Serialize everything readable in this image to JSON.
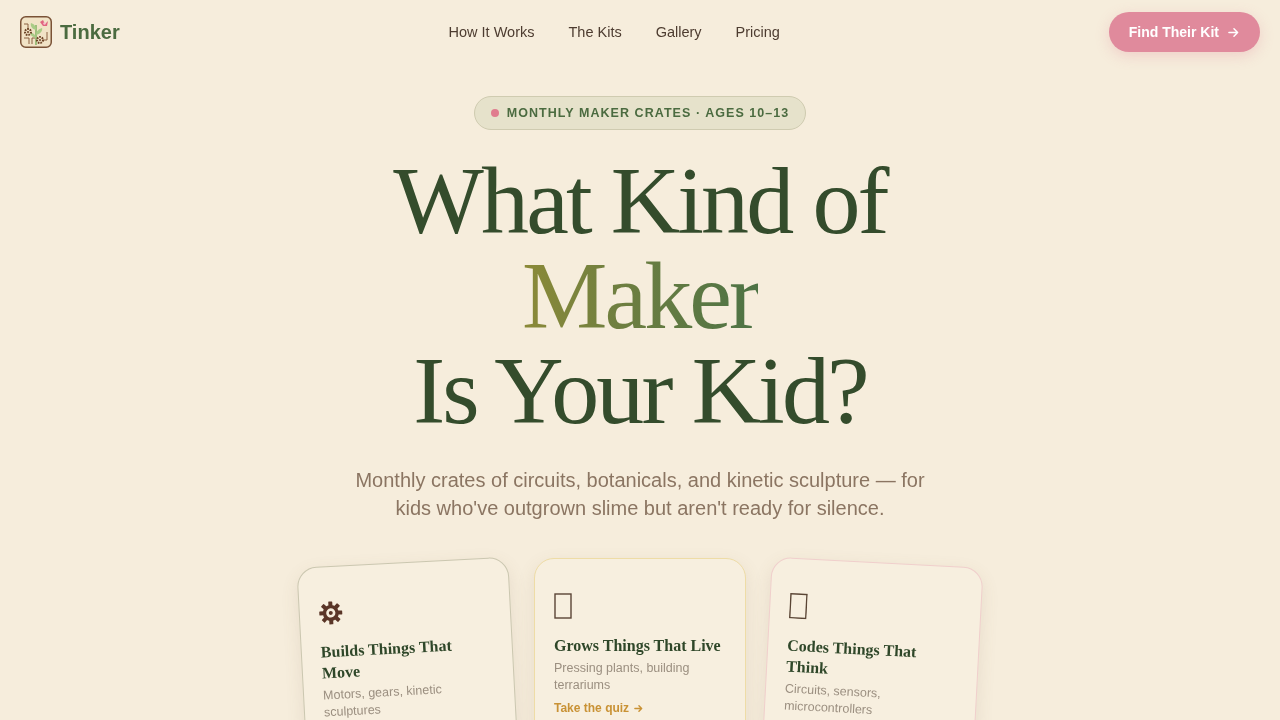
{
  "nav": {
    "brand": "Tinker",
    "links": [
      "How It Works",
      "The Kits",
      "Gallery",
      "Pricing"
    ],
    "cta": "Find Their Kit"
  },
  "badge": "MONTHLY MAKER CRATES · AGES 10–13",
  "headline": {
    "before": "What Kind of",
    "accent": "Maker",
    "after": "Is Your Kid?"
  },
  "subtitle": "Monthly crates of circuits, botanicals, and kinetic sculpture — for kids who've outgrown slime but aren't ready for silence.",
  "kits": [
    {
      "title": "Builds Things That Move",
      "description": "Motors, gears, kinetic sculptures",
      "color": "#cbc7b0"
    },
    {
      "title": "Grows Things That Live",
      "description": "Pressing plants, building terrariums",
      "link": "Take the quiz",
      "color": "#eedca6"
    },
    {
      "title": "Codes Things That Think",
      "description": "Circuits, sensors, microcontrollers",
      "color": "#f0cfcc"
    }
  ]
}
